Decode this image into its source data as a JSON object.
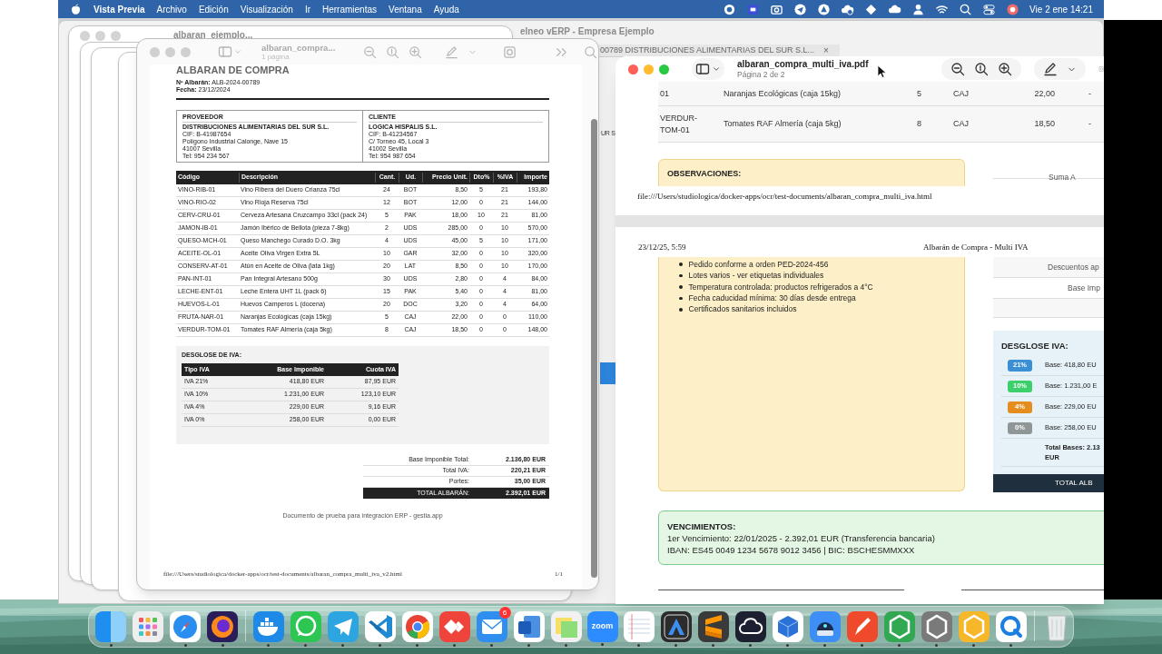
{
  "menu_bar": {
    "app": "Vista Previa",
    "menus": [
      "Archivo",
      "Edición",
      "Visualización",
      "Ir",
      "Herramientas",
      "Ventana",
      "Ayuda"
    ],
    "clock": "Vie 2 ene 14:21"
  },
  "background_windows": {
    "erp_title": "elneo vERP - Empresa Ejemplo",
    "erp_tab": "00789 DISTRIBUCIONES ALIMENTARIAS DEL SUR S.L...",
    "erp_tab_close": "×",
    "erp_fragment": "UR S.",
    "preview_title": "albaran_ejemplo..."
  },
  "left_window": {
    "title": "albaran_compra...",
    "subtitle": "1 página",
    "document": {
      "heading": "ALBARAN DE COMPRA",
      "meta": [
        "**Nº Albarán:** ALB-2024-00789",
        "**Fecha:** 23/12/2024"
      ],
      "parties": [
        {
          "title": "PROVEEDOR",
          "name": "DISTRIBUCIONES ALIMENTARIAS DEL SUR S.L.",
          "lines": [
            "CIF: B-41987654",
            "Polígono Industrial Calonge, Nave 15",
            "41007 Sevilla",
            "Tel: 954 234 567"
          ]
        },
        {
          "title": "CLIENTE",
          "name": "LOGICA HISPALIS S.L.",
          "lines": [
            "CIF: B-41234567",
            "C/ Torneo 45, Local 3",
            "41002 Sevilla",
            "Tel: 954 987 654"
          ]
        }
      ],
      "columns": [
        "Código",
        "Descripción",
        "Cant.",
        "Ud.",
        "Precio Unit.",
        "Dto%",
        "%IVA",
        "Importe"
      ],
      "rows": [
        [
          "VINO-RIB-01",
          "Vino Ribera del Duero Crianza 75cl",
          "24",
          "BOT",
          "8,50",
          "5",
          "21",
          "193,80"
        ],
        [
          "VINO-RIO-02",
          "Vino Rioja Reserva 75cl",
          "12",
          "BOT",
          "12,00",
          "0",
          "21",
          "144,00"
        ],
        [
          "CERV-CRU-01",
          "Cerveza Artesana Cruzcampo 33cl (pack 24)",
          "5",
          "PAK",
          "18,00",
          "10",
          "21",
          "81,00"
        ],
        [
          "JAMON-IB-01",
          "Jamón Ibérico de Bellota (pieza 7-8kg)",
          "2",
          "UDS",
          "285,00",
          "0",
          "10",
          "570,00"
        ],
        [
          "QUESO-MCH-01",
          "Queso Manchego Curado D.O. 3kg",
          "4",
          "UDS",
          "45,00",
          "5",
          "10",
          "171,00"
        ],
        [
          "ACEITE-OL-01",
          "Aceite Oliva Virgen Extra 5L",
          "10",
          "GAR",
          "32,00",
          "0",
          "10",
          "320,00"
        ],
        [
          "CONSERV-AT-01",
          "Atún en Aceite de Oliva (lata 1kg)",
          "20",
          "LAT",
          "8,50",
          "0",
          "10",
          "170,00"
        ],
        [
          "PAN-INT-01",
          "Pan Integral Artesano 500g",
          "30",
          "UDS",
          "2,80",
          "0",
          "4",
          "84,00"
        ],
        [
          "LECHE-ENT-01",
          "Leche Entera UHT 1L (pack 6)",
          "15",
          "PAK",
          "5,40",
          "0",
          "4",
          "81,00"
        ],
        [
          "HUEVOS-L-01",
          "Huevos Camperos L (docena)",
          "20",
          "DOC",
          "3,20",
          "0",
          "4",
          "64,00"
        ],
        [
          "FRUTA-NAR-01",
          "Naranjas Ecológicas (caja 15kg)",
          "5",
          "CAJ",
          "22,00",
          "0",
          "0",
          "110,00"
        ],
        [
          "VERDUR-TOM-01",
          "Tomates RAF Almería (caja 5kg)",
          "8",
          "CAJ",
          "18,50",
          "0",
          "0",
          "148,00"
        ]
      ],
      "vat_breakdown": {
        "title": "DESGLOSE DE IVA:",
        "columns": [
          "Tipo IVA",
          "Base Imponible",
          "Cuota IVA"
        ],
        "rows": [
          [
            "IVA 21%",
            "418,80 EUR",
            "87,95 EUR"
          ],
          [
            "IVA 10%",
            "1.231,00 EUR",
            "123,10 EUR"
          ],
          [
            "IVA 4%",
            "229,00 EUR",
            "9,16 EUR"
          ],
          [
            "IVA 0%",
            "258,00 EUR",
            "0,00 EUR"
          ]
        ]
      },
      "totals": [
        {
          "label": "Base Imponible Total:",
          "value": "2.136,80 EUR",
          "grand": false
        },
        {
          "label": "Total IVA:",
          "value": "220,21 EUR",
          "grand": false
        },
        {
          "label": "Portes:",
          "value": "35,00 EUR",
          "grand": false
        },
        {
          "label": "TOTAL ALBARÁN:",
          "value": "2.392,01 EUR",
          "grand": true
        }
      ],
      "footer_note": "Documento de prueba para integración ERP - gestia.app",
      "print_path": "file:///Users/studiologica/docker-apps/ocr/test-documents/albaran_compra_multi_iva_v2.html",
      "print_page": "1/1"
    }
  },
  "right_window": {
    "title": "albaran_compra_multi_iva.pdf",
    "subtitle": "Página 2 de 2",
    "table_rows": [
      [
        "01",
        "Naranjas Ecológicas (caja 15kg)",
        "5",
        "CAJ",
        "22,00",
        "-"
      ],
      [
        "VERDUR-TOM-01",
        "Tomates RAF Almería (caja 5kg)",
        "8",
        "CAJ",
        "18,50",
        "-"
      ]
    ],
    "observations_title": "OBSERVACIONES:",
    "summary_first": "Suma A",
    "page1_footer": "file:///Users/studiologica/docker-apps/ocr/test-documents/albaran_compra_multi_iva.html",
    "page2_date": "23/12/25, 5:59",
    "page2_title": "Albarán de Compra - Multi IVA",
    "observations": [
      "Pedido conforme a orden PED-2024-456",
      "Lotes varios - ver etiquetas individuales",
      "Temperatura controlada: productos refrigerados a 4°C",
      "Fecha caducidad mínima: 30 días desde entrega",
      "Certificados sanitarios incluidos"
    ],
    "summary_rows": [
      "Descuentos ap",
      "Base Imp"
    ],
    "vat": {
      "title": "DESGLOSE IVA:",
      "rows": [
        {
          "rate": "21%",
          "color": "#3b8fd4",
          "base": "Base: 418,80 EU"
        },
        {
          "rate": "10%",
          "color": "#3ccf6a",
          "base": "Base: 1.231,00 E"
        },
        {
          "rate": "4%",
          "color": "#e58e1f",
          "base": "Base: 229,00 EU"
        },
        {
          "rate": "0%",
          "color": "#8e9696",
          "base": "Base: 258,00 EU"
        }
      ],
      "total_lines": [
        "Total Bases: 2.13",
        "EUR"
      ],
      "grand": "TOTAL ALB"
    },
    "due": {
      "title": "VENCIMIENTOS:",
      "lines": [
        "1er Vencimiento: 22/01/2025 - 2.392,01 EUR (Transferencia bancaria)",
        "IBAN: ES45 0049 1234 5678 9012 3456 | BIC: BSCHESMMXXX"
      ]
    }
  },
  "dock": {
    "items": [
      {
        "kind": "finder",
        "running": true
      },
      {
        "kind": "launchpad",
        "running": false
      },
      {
        "kind": "safari",
        "running": true
      },
      {
        "kind": "firefox",
        "running": true
      },
      {
        "kind": "docker",
        "running": true
      },
      {
        "kind": "whatsapp",
        "running": true
      },
      {
        "kind": "telegram",
        "running": true
      },
      {
        "kind": "vscode",
        "running": true
      },
      {
        "kind": "chrome",
        "running": true
      },
      {
        "kind": "anydesk",
        "running": true
      },
      {
        "kind": "mail",
        "running": true,
        "badge": "6"
      },
      {
        "kind": "word",
        "running": true
      },
      {
        "kind": "stickies",
        "running": true
      },
      {
        "kind": "zoom",
        "running": true,
        "label": "zoom"
      },
      {
        "kind": "textedit",
        "running": true
      },
      {
        "kind": "dark_a",
        "running": true
      },
      {
        "kind": "sublime",
        "running": true
      },
      {
        "kind": "cloud",
        "running": true
      },
      {
        "kind": "outlook",
        "running": true
      },
      {
        "kind": "robot",
        "running": true
      },
      {
        "kind": "pen",
        "running": true
      },
      {
        "kind": "hex_green",
        "running": true
      },
      {
        "kind": "hex_gray",
        "running": true
      },
      {
        "kind": "hex_yellow",
        "running": true
      },
      {
        "kind": "quicktime",
        "running": true
      },
      {
        "kind": "trash",
        "running": false
      }
    ]
  }
}
